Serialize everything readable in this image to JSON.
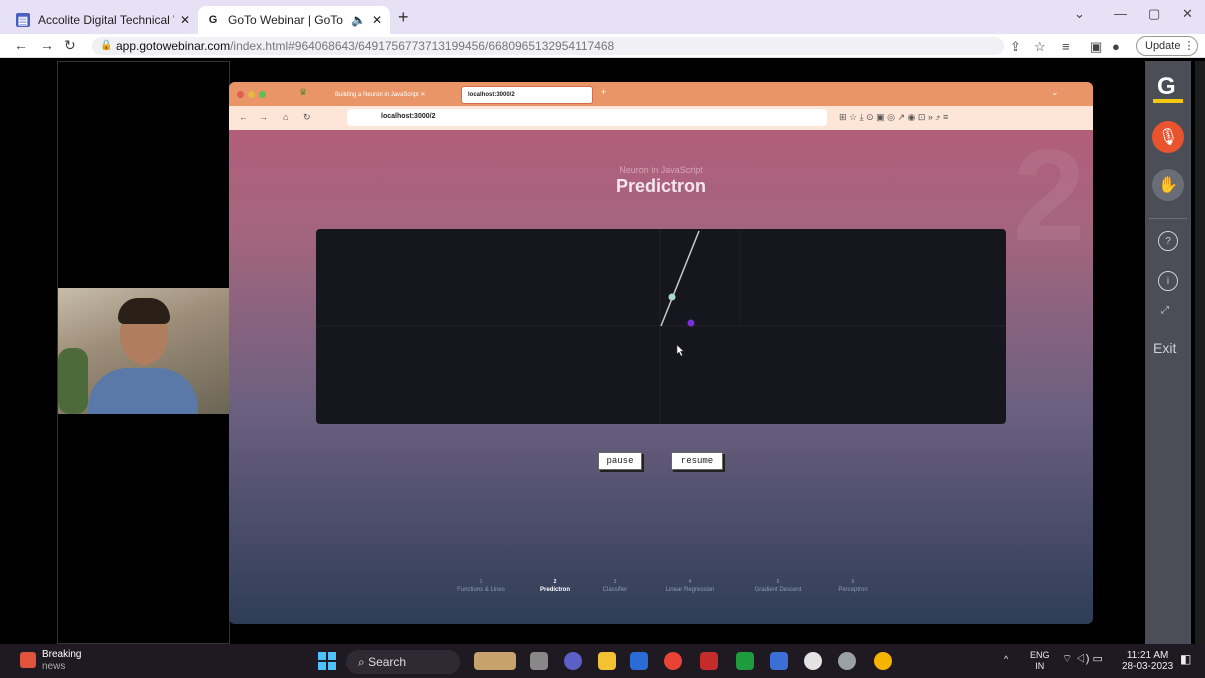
{
  "browser": {
    "tabs": [
      {
        "title": "Accolite Digital Technical Webina",
        "active": false
      },
      {
        "title": "GoTo Webinar | GoTo Webina",
        "active": true
      }
    ],
    "new_tab": "+",
    "url_host": "app.gotowebinar.com",
    "url_path": "/index.html#964068643/6491756773713199456/6680965132954117468",
    "update_label": "Update"
  },
  "shared_screen": {
    "tabs": [
      {
        "title": "Building a Neuron in JavaScript"
      },
      {
        "title": "localhost:3000/2"
      }
    ],
    "url": "localhost:3000/2",
    "slide": {
      "subtitle": "Neuron in JavaScript",
      "title": "Predictron",
      "bg_number": "2",
      "buttons": {
        "pause": "pause",
        "resume": "resume"
      },
      "nav": [
        {
          "num": "1",
          "label": "Functions & Lines",
          "active": false
        },
        {
          "num": "2",
          "label": "Predictron",
          "active": true
        },
        {
          "num": "3",
          "label": "Classifier",
          "active": false
        },
        {
          "num": "4",
          "label": "Linear Regression",
          "active": false
        },
        {
          "num": "5",
          "label": "Gradient Descent",
          "active": false
        },
        {
          "num": "6",
          "label": "Perceptron",
          "active": false
        }
      ]
    }
  },
  "sidebar": {
    "logo": "G",
    "exit_label": "Exit",
    "accent": "#e9532d"
  },
  "taskbar": {
    "news_title": "Breaking",
    "news_sub": "news",
    "search_label": "Search",
    "lang_top": "ENG",
    "lang_bottom": "IN",
    "time": "11:21 AM",
    "date": "28-03-2023"
  }
}
